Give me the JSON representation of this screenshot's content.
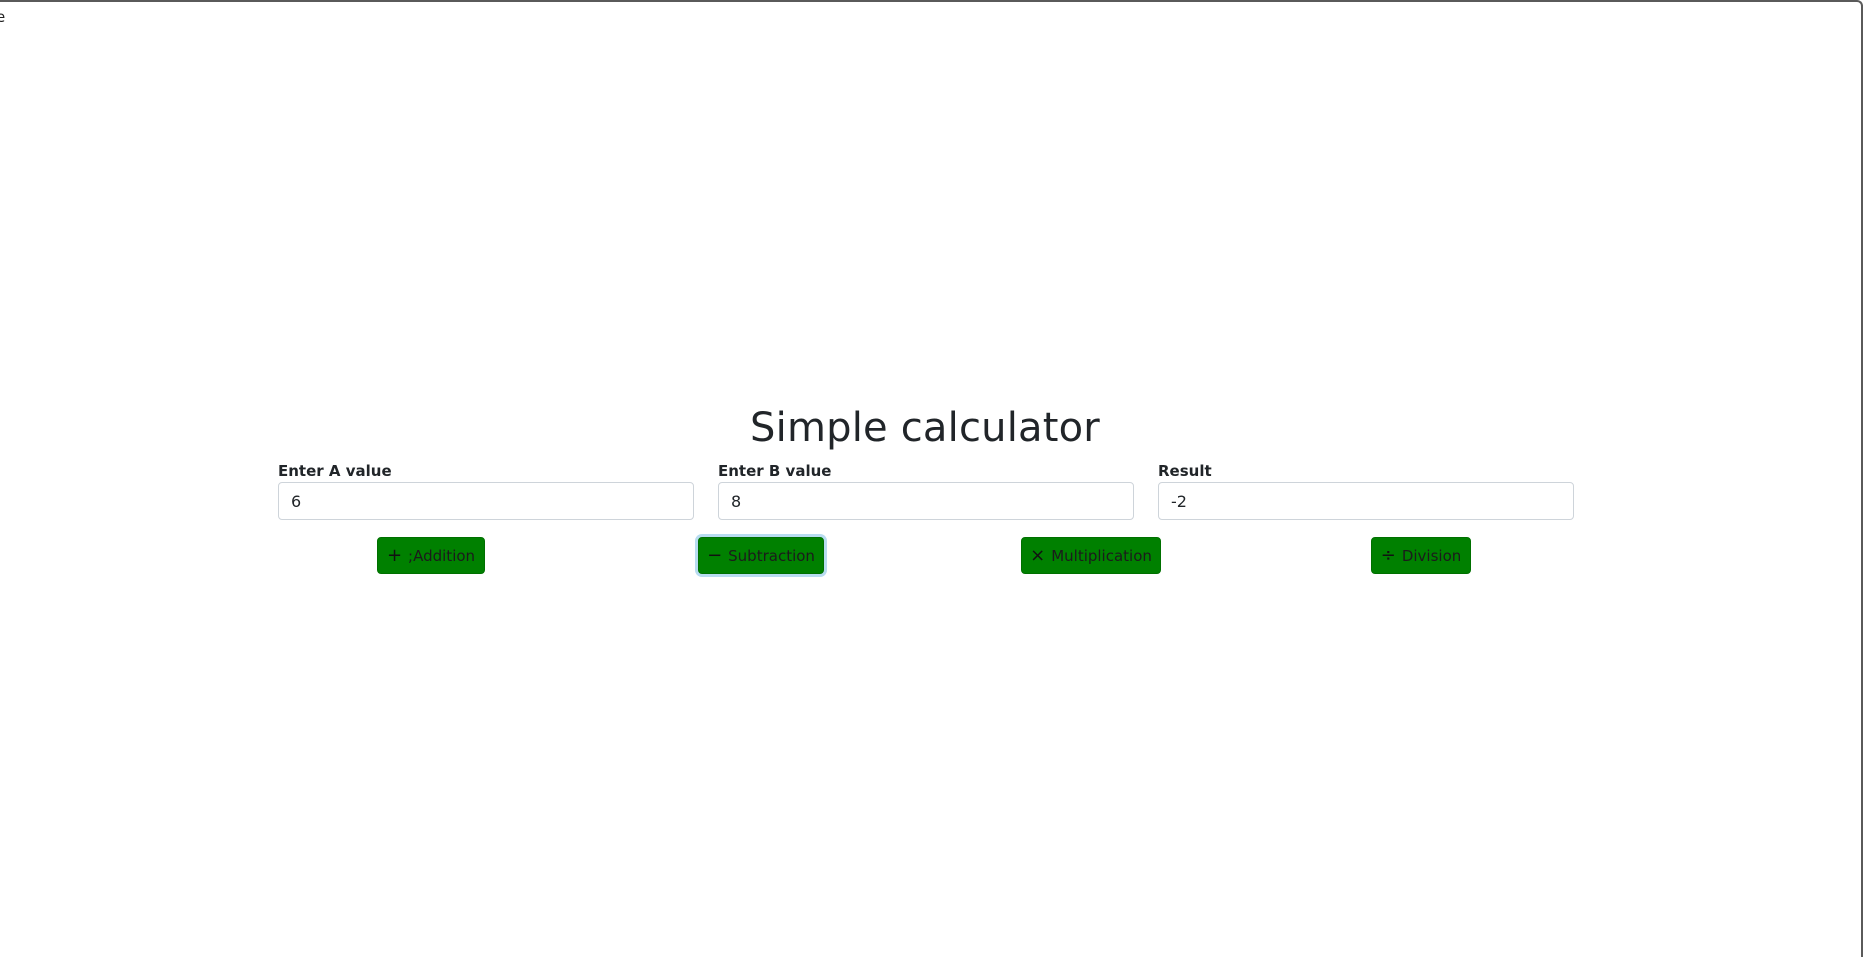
{
  "corner_glyph": "e",
  "title": "Simple calculator",
  "fields": {
    "a": {
      "label": "Enter A value",
      "value": "6"
    },
    "b": {
      "label": "Enter B value",
      "value": "8"
    },
    "result": {
      "label": "Result",
      "value": "-2"
    }
  },
  "buttons": {
    "addition": {
      "icon": "+",
      "label": ";Addition",
      "icon_name": "plus-icon"
    },
    "subtraction": {
      "icon": "−",
      "label": "Subtraction",
      "icon_name": "minus-icon",
      "state": "focused"
    },
    "multiplication": {
      "icon": "×",
      "label": "Multiplication",
      "icon_name": "multiply-icon"
    },
    "division": {
      "icon": "÷",
      "label": "Division",
      "icon_name": "divide-icon"
    }
  },
  "colors": {
    "button_bg": "#008000",
    "focus_ring": "#b8dcf0",
    "text": "#212529"
  }
}
